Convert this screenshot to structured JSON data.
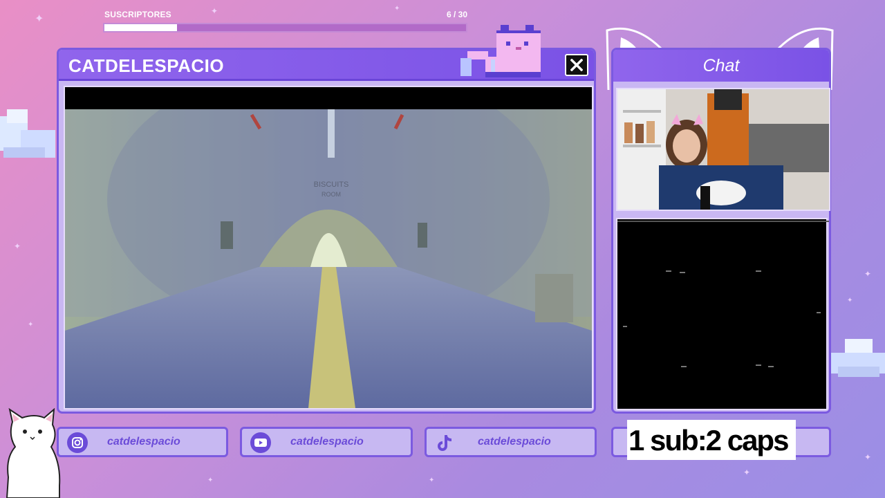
{
  "subscribers": {
    "label": "SUSCRIPTORES",
    "count_text": "6  / 30",
    "progress": 0.2
  },
  "main_window": {
    "title": "CATDELESPACIO",
    "close_icon": "close-icon"
  },
  "video": {
    "sign_line1": "BISCUITS",
    "sign_line2": "ROOM"
  },
  "chat": {
    "title": "Chat"
  },
  "socials": [
    {
      "icon": "instagram-icon",
      "handle": "catdelespacio"
    },
    {
      "icon": "youtube-icon",
      "handle": "catdelespacio"
    },
    {
      "icon": "tiktok-icon",
      "handle": "catdelespacio"
    }
  ],
  "promo": {
    "text": "1 sub:2 caps"
  },
  "colors": {
    "accent": "#7b5ae0",
    "panel": "#c9b7f3",
    "background_pink": "#e98fc6",
    "background_purple": "#9b8fe6"
  }
}
